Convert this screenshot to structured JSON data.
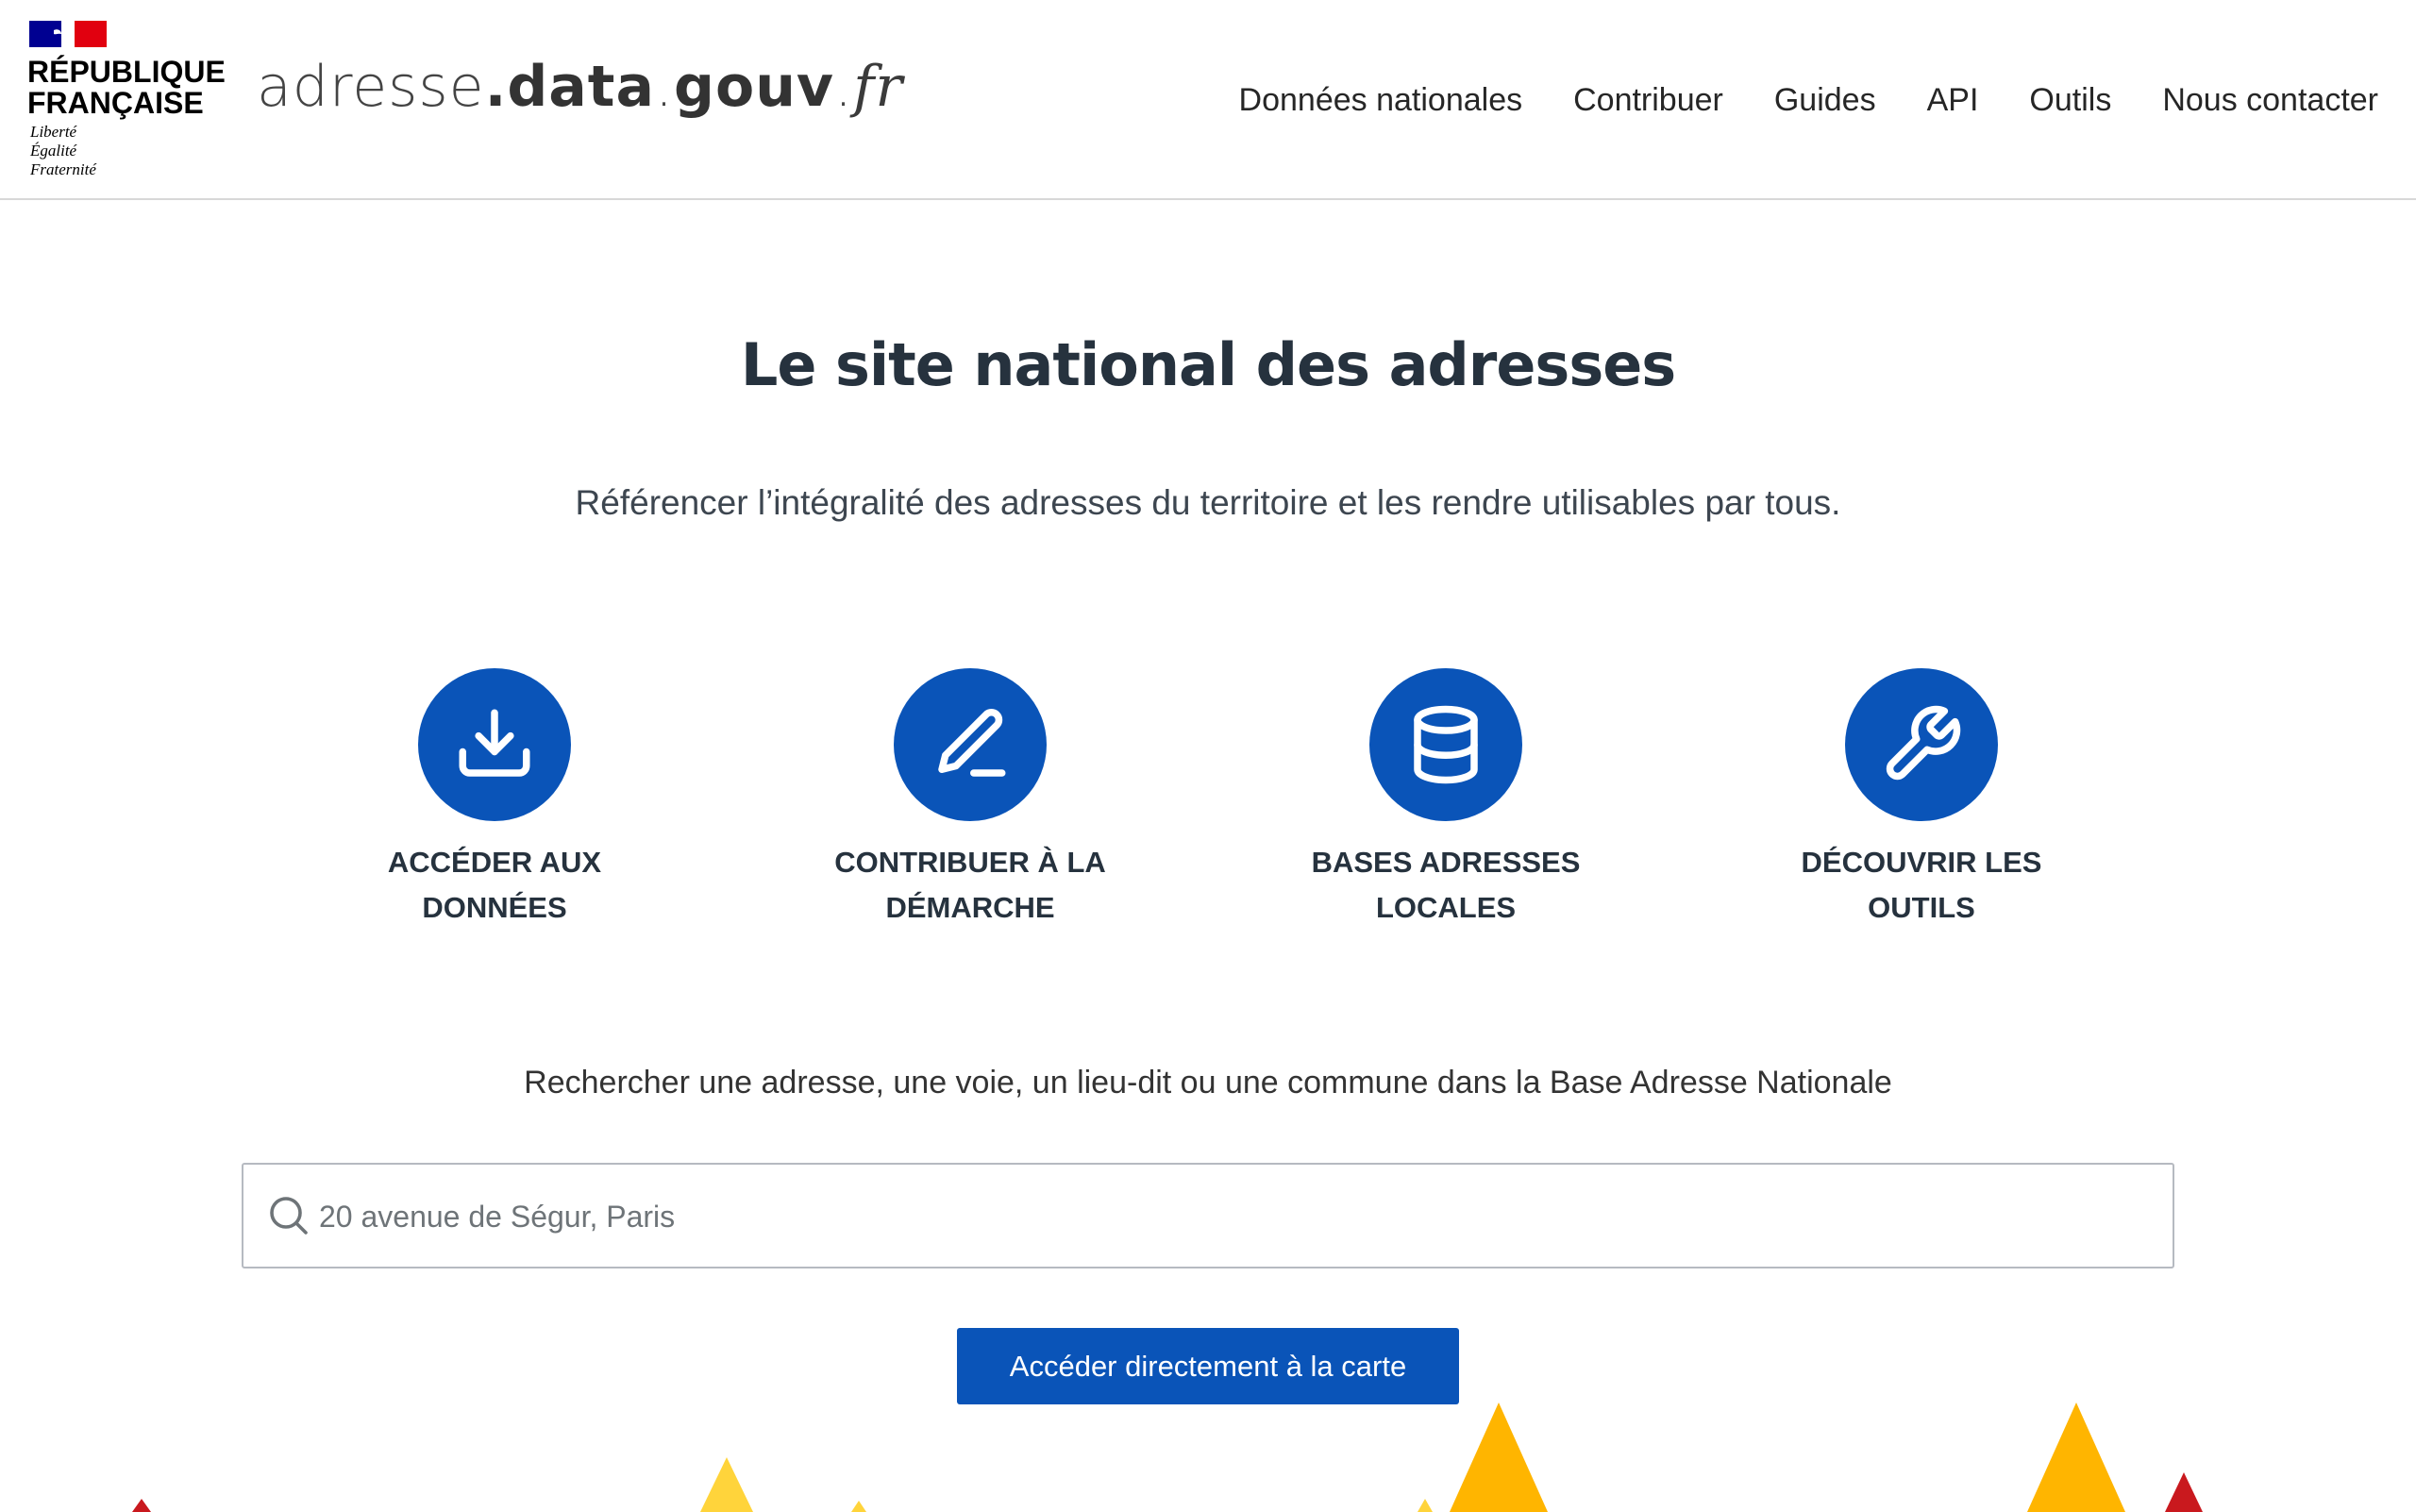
{
  "header": {
    "rf_line1": "RÉPUBLIQUE",
    "rf_line2": "FRANÇAISE",
    "devise_1": "Liberté",
    "devise_2": "Égalité",
    "devise_3": "Fraternité",
    "site_prefix": "adresse",
    "site_dot1": ".",
    "site_middle": "data",
    "site_dot2": ".",
    "site_gouv": "gouv",
    "site_dot3": ".",
    "site_fr": "fr"
  },
  "nav": {
    "items": [
      "Données nationales",
      "Contribuer",
      "Guides",
      "API",
      "Outils",
      "Nous contacter"
    ]
  },
  "hero": {
    "title": "Le site national des adresses",
    "subtitle": "Référencer l’intégralité des adresses du territoire et les rendre utilisables par tous."
  },
  "cards": [
    {
      "label": "ACCÉDER AUX DONNÉES",
      "icon": "download-icon"
    },
    {
      "label": "CONTRIBUER À LA DÉMARCHE",
      "icon": "pencil-icon"
    },
    {
      "label": "BASES ADRESSES LOCALES",
      "icon": "database-icon"
    },
    {
      "label": "DÉCOUVRIR LES OUTILS",
      "icon": "wrench-icon"
    }
  ],
  "search": {
    "title": "Rechercher une adresse, une voie, un lieu-dit ou une commune dans la Base Adresse Nationale",
    "placeholder": "20 avenue de Ségur, Paris",
    "button": "Accéder directement à la carte"
  },
  "colors": {
    "primary": "#0a54b8",
    "text": "#26323e",
    "yellow": "#ffd43b",
    "orange": "#ffb500",
    "red": "#c9191e"
  }
}
